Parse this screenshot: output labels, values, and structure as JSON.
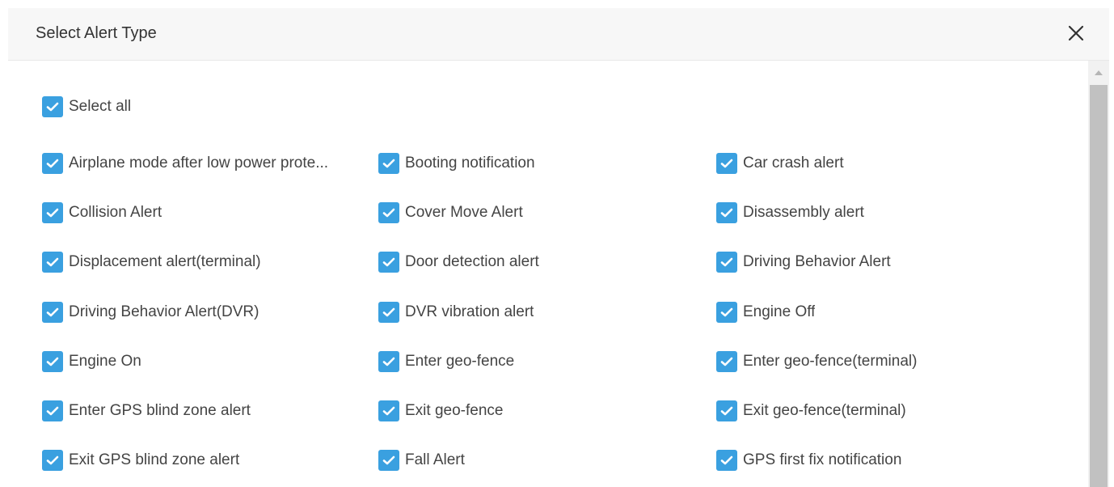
{
  "dialog": {
    "title": "Select Alert Type",
    "close_icon": "close-icon"
  },
  "select_all": {
    "label": "Select all",
    "checked": true
  },
  "alert_types": [
    {
      "label": "Airplane mode after low power prote...",
      "checked": true
    },
    {
      "label": "Booting notification",
      "checked": true
    },
    {
      "label": "Car crash alert",
      "checked": true
    },
    {
      "label": "Collision Alert",
      "checked": true
    },
    {
      "label": "Cover Move Alert",
      "checked": true
    },
    {
      "label": "Disassembly alert",
      "checked": true
    },
    {
      "label": "Displacement alert(terminal)",
      "checked": true
    },
    {
      "label": "Door detection alert",
      "checked": true
    },
    {
      "label": "Driving Behavior Alert",
      "checked": true
    },
    {
      "label": "Driving Behavior Alert(DVR)",
      "checked": true
    },
    {
      "label": "DVR vibration alert",
      "checked": true
    },
    {
      "label": "Engine Off",
      "checked": true
    },
    {
      "label": "Engine On",
      "checked": true
    },
    {
      "label": "Enter geo-fence",
      "checked": true
    },
    {
      "label": "Enter geo-fence(terminal)",
      "checked": true
    },
    {
      "label": "Enter GPS blind zone alert",
      "checked": true
    },
    {
      "label": "Exit geo-fence",
      "checked": true
    },
    {
      "label": "Exit geo-fence(terminal)",
      "checked": true
    },
    {
      "label": "Exit GPS blind zone alert",
      "checked": true
    },
    {
      "label": "Fall Alert",
      "checked": true
    },
    {
      "label": "GPS first fix notification",
      "checked": true
    }
  ],
  "colors": {
    "checkbox_accent": "#3aa0e0",
    "header_bg": "#f7f7f7",
    "label_text": "#444444"
  }
}
